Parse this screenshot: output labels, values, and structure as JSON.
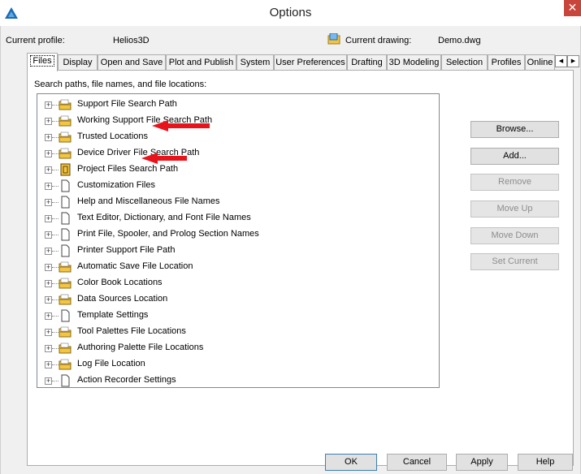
{
  "window": {
    "title": "Options",
    "close_glyph": "✕"
  },
  "profile": {
    "current_profile_label": "Current profile:",
    "current_profile_value": "Helios3D",
    "current_drawing_label": "Current drawing:",
    "current_drawing_value": "Demo.dwg"
  },
  "tabs": [
    {
      "label": "Files",
      "active": true
    },
    {
      "label": "Display"
    },
    {
      "label": "Open and Save"
    },
    {
      "label": "Plot and Publish"
    },
    {
      "label": "System"
    },
    {
      "label": "User Preferences"
    },
    {
      "label": "Drafting"
    },
    {
      "label": "3D Modeling"
    },
    {
      "label": "Selection"
    },
    {
      "label": "Profiles"
    },
    {
      "label": "Online"
    }
  ],
  "tab_scroll": {
    "left_glyph": "◀",
    "right_glyph": "▶"
  },
  "files_panel": {
    "label": "Search paths, file names, and file locations:",
    "items": [
      {
        "label": "Support File Search Path",
        "icon": "folder-icon",
        "highlighted": true
      },
      {
        "label": "Working Support File Search Path",
        "icon": "folder-icon"
      },
      {
        "label": "Trusted Locations",
        "icon": "folder-icon",
        "highlighted": true
      },
      {
        "label": "Device Driver File Search Path",
        "icon": "folder-icon"
      },
      {
        "label": "Project Files Search Path",
        "icon": "project-file-icon"
      },
      {
        "label": "Customization Files",
        "icon": "document-icon"
      },
      {
        "label": "Help and Miscellaneous File Names",
        "icon": "document-icon"
      },
      {
        "label": "Text Editor, Dictionary, and Font File Names",
        "icon": "document-icon"
      },
      {
        "label": "Print File, Spooler, and Prolog Section Names",
        "icon": "document-icon"
      },
      {
        "label": "Printer Support File Path",
        "icon": "document-icon"
      },
      {
        "label": "Automatic Save File Location",
        "icon": "folder-icon"
      },
      {
        "label": "Color Book Locations",
        "icon": "folder-icon"
      },
      {
        "label": "Data Sources Location",
        "icon": "folder-icon"
      },
      {
        "label": "Template Settings",
        "icon": "document-icon"
      },
      {
        "label": "Tool Palettes File Locations",
        "icon": "folder-icon"
      },
      {
        "label": "Authoring Palette File Locations",
        "icon": "folder-icon"
      },
      {
        "label": "Log File Location",
        "icon": "folder-icon"
      },
      {
        "label": "Action Recorder Settings",
        "icon": "document-icon"
      }
    ],
    "expander_glyph": "+",
    "scroll_up_glyph": "▲",
    "scroll_down_glyph": "▼"
  },
  "side_buttons": {
    "browse": "Browse...",
    "add": "Add...",
    "remove": "Remove",
    "move_up": "Move Up",
    "move_down": "Move Down",
    "set_current": "Set Current"
  },
  "bottom_buttons": {
    "ok": "OK",
    "cancel": "Cancel",
    "apply": "Apply",
    "help": "Help"
  },
  "colors": {
    "annotation_arrow": "#e8141c",
    "folder": "#f4c542",
    "close_button": "#c7453a"
  }
}
